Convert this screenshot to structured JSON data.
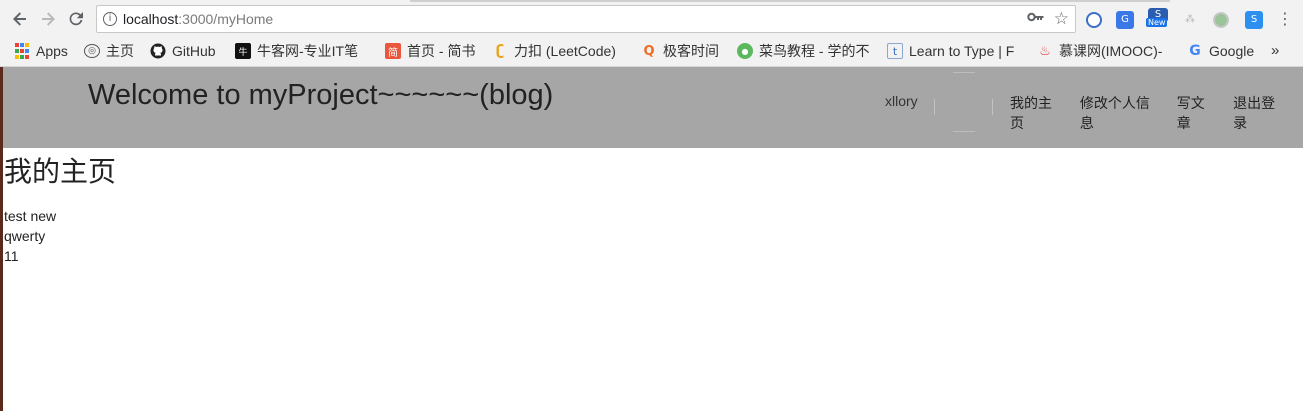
{
  "browser": {
    "url_host": "localhost",
    "url_path": ":3000/myHome",
    "bookmarks": [
      {
        "label": "Apps",
        "icon": "apps-grid-icon"
      },
      {
        "label": "主页",
        "icon": "home-globe-icon"
      },
      {
        "label": "GitHub",
        "icon": "github-icon"
      },
      {
        "label": "牛客网-专业IT笔",
        "icon": "nowcoder-icon"
      },
      {
        "label": "首页 - 简书",
        "icon": "jianshu-icon"
      },
      {
        "label": "力扣 (LeetCode)",
        "icon": "leetcode-icon"
      },
      {
        "label": "极客时间",
        "icon": "geektime-icon"
      },
      {
        "label": "菜鸟教程 - 学的不",
        "icon": "runoob-icon"
      },
      {
        "label": "Learn to Type | F",
        "icon": "typing-icon"
      },
      {
        "label": "慕课网(IMOOC)-",
        "icon": "imooc-icon"
      },
      {
        "label": "Google",
        "icon": "google-icon"
      }
    ],
    "more_bookmarks": "»",
    "extension_badge": "New",
    "colors": {
      "chrome_bg": "#f2f2f2",
      "header_bg": "#a6a6a6",
      "badge_blue": "#1a73e8"
    }
  },
  "site": {
    "brand": "Welcome to myProject~~~~~~(blog)",
    "user": "xllory",
    "nav": [
      "我的主页",
      "修改个人信息",
      "写文章",
      "退出登录"
    ]
  },
  "main": {
    "title": "我的主页",
    "posts": [
      "test new",
      "qwerty",
      "11"
    ]
  }
}
